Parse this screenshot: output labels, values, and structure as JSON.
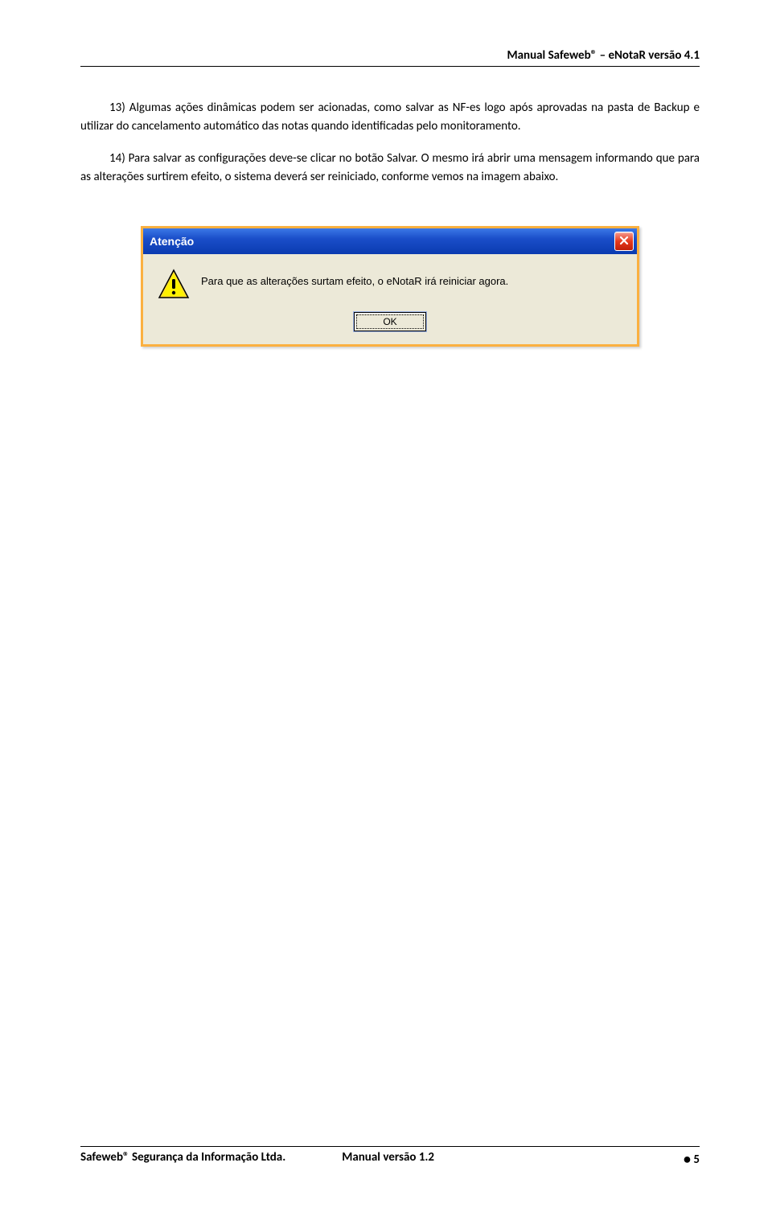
{
  "header": {
    "title": "Manual Safeweb® – eNotaR versão 4.1"
  },
  "paragraphs": {
    "p1": "13) Algumas ações dinâmicas podem ser acionadas, como salvar as NF-es logo após aprovadas na pasta de Backup e utilizar do cancelamento automático das notas quando identificadas pelo monitoramento.",
    "p2": "14) Para salvar as configurações deve-se clicar no botão Salvar. O mesmo irá abrir uma mensagem informando que para as alterações surtirem efeito, o sistema deverá ser reiniciado, conforme vemos na imagem abaixo."
  },
  "dialog": {
    "title": "Atenção",
    "message": "Para que as alterações surtam efeito, o eNotaR irá reiniciar agora.",
    "ok_label": "OK"
  },
  "footer": {
    "left": "Safeweb® Segurança da Informação Ltda.",
    "center": "Manual versão 1.2",
    "right_bullet": "•",
    "right_page": " 5"
  }
}
